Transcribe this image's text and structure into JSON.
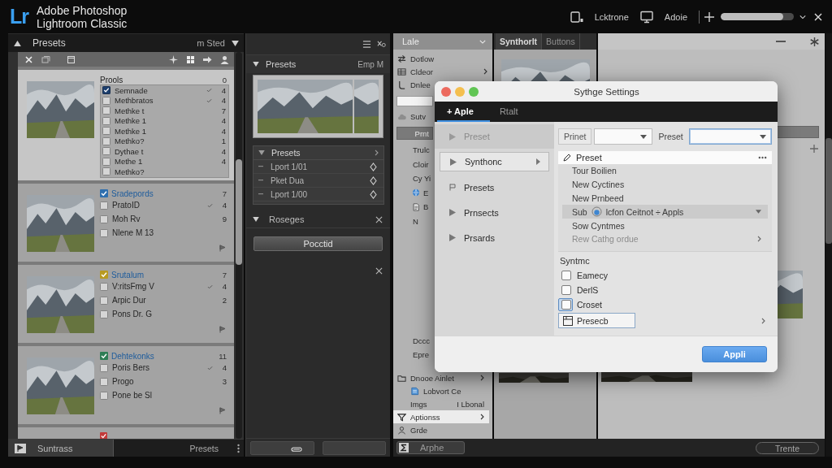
{
  "app_bar": {
    "logo": "Lr",
    "title": [
      "Adobe Photoshop",
      "Lightroom Classic"
    ],
    "tools": [
      {
        "kind": "device",
        "label": "Lcktrone"
      },
      {
        "kind": "monitor",
        "label": "Adoie"
      }
    ],
    "zoom": {
      "level": 0.86
    }
  },
  "presets_panel": {
    "title": "Presets",
    "filter": "m Sted",
    "cards": [
      {
        "selected": true,
        "title": "Prools",
        "count": "0",
        "flag": false,
        "rows": [
          {
            "label": "Semnade",
            "checked": true,
            "ticked": true,
            "count": "4"
          },
          {
            "label": "Methbratos",
            "checked": false,
            "ticked": true,
            "count": "4"
          },
          {
            "label": "Methke t",
            "checked": false,
            "ticked": false,
            "count": "7"
          },
          {
            "label": "Methke 1",
            "checked": false,
            "ticked": false,
            "count": "4"
          },
          {
            "label": "Methke 1",
            "checked": false,
            "ticked": false,
            "count": "4"
          },
          {
            "label": "Methko?",
            "checked": false,
            "ticked": false,
            "count": "1"
          },
          {
            "label": "Dythae t",
            "checked": false,
            "ticked": false,
            "count": "4"
          },
          {
            "label": "Methe 1",
            "checked": false,
            "ticked": false,
            "count": "4"
          },
          {
            "label": "Methko?",
            "checked": false,
            "ticked": false
          }
        ]
      },
      {
        "selected": false,
        "title": "Sradepords",
        "color": "#2f6fae",
        "count": "7",
        "flag": true,
        "rows": [
          {
            "label": "PratoID",
            "checked": false,
            "ticked": true,
            "count": "4"
          },
          {
            "label": "Moh Rv",
            "checked": false,
            "ticked": false,
            "count": "9"
          },
          {
            "label": "Nlene M 13",
            "checked": false,
            "ticked": false
          }
        ]
      },
      {
        "selected": false,
        "title": "Srutalum",
        "color": "#b89a22",
        "count": "7",
        "flag": true,
        "rows": [
          {
            "label": "V:ritsFmg V",
            "checked": false,
            "ticked": true,
            "count": "4"
          },
          {
            "label": "Arpic Dur",
            "checked": false,
            "ticked": false,
            "count": "2"
          },
          {
            "label": "Pons Dr. G",
            "checked": false,
            "ticked": false
          }
        ]
      },
      {
        "selected": false,
        "title": "Dehtekonks",
        "color": "#2e7d55",
        "count": "11",
        "flag": true,
        "rows": [
          {
            "label": "Poris Bers",
            "checked": false,
            "ticked": true,
            "count": "4"
          },
          {
            "label": "Progo",
            "checked": false,
            "ticked": false,
            "count": "3"
          },
          {
            "label": "Pone be Sl",
            "checked": false,
            "ticked": false
          }
        ]
      },
      {
        "selected": false,
        "color": "#c23a3a",
        "flag": false
      }
    ],
    "footer": {
      "button": "Suntrass",
      "label": "Presets"
    }
  },
  "develop_panel": {
    "title": "Presets",
    "meta": "Emp M",
    "list_title": "Presets",
    "items": [
      "Lport 1/01",
      "Pket Dua",
      "Lport 1/00"
    ],
    "section": "Roseges",
    "button": "Pocctid"
  },
  "library": {
    "title": "Lale",
    "items": [
      {
        "kind": "swap",
        "label": "Dotlow",
        "more": false
      },
      {
        "kind": "grid",
        "label": "Cldeor",
        "more": true
      },
      {
        "kind": "hook",
        "label": "Dnlee",
        "more": false
      }
    ],
    "sync": {
      "kind": "cloud",
      "label": "Sutv"
    },
    "button": "Prnt",
    "list": [
      {
        "label": "Trulc"
      },
      {
        "label": "Cloir"
      },
      {
        "label": "Cy Yi"
      },
      {
        "kind": "globe",
        "label": "E"
      },
      {
        "kind": "doc",
        "label": "B"
      },
      {
        "label": "N"
      }
    ],
    "lower": [
      "Dccc",
      "Epre"
    ],
    "nav": [
      {
        "kind": "folder",
        "label": "Dnooe Ainlet",
        "more": true,
        "selected": false,
        "children": [
          {
            "kind": "bluedoc",
            "label": "Lobvort Ce",
            "more": false,
            "selected": false
          }
        ]
      },
      {
        "label": "Imgs",
        "meta": "I Lbonal",
        "more": false,
        "selected": false
      },
      {
        "kind": "funnel",
        "label": "Aptionss",
        "more": true,
        "selected": true
      },
      {
        "kind": "person",
        "label": "Grde",
        "more": false,
        "selected": false
      }
    ],
    "footer_button": "Arphe"
  },
  "filmstrip": {
    "tabs": [
      {
        "label": "Synthorlt",
        "selected": true
      },
      {
        "label": "Buttons",
        "selected": false
      }
    ]
  },
  "viewer": {
    "button": "Trente"
  },
  "dialog": {
    "title": "Sythge Settings",
    "tabs": [
      {
        "label": "+ Aple",
        "selected": true
      },
      {
        "label": "Rtalt",
        "selected": false
      }
    ],
    "sidebar": [
      {
        "kind": "arrow",
        "label": "Preset",
        "selected": false,
        "disabled": true,
        "more": false
      },
      {
        "kind": "arrow",
        "label": "Synthonc",
        "selected": true,
        "disabled": false,
        "more": true
      },
      {
        "kind": "flag",
        "label": "Presets",
        "selected": false,
        "disabled": false,
        "more": false
      },
      {
        "kind": "arrow",
        "label": "Prnsects",
        "selected": false,
        "disabled": false,
        "more": false
      },
      {
        "kind": "arrow",
        "label": "Prsards",
        "selected": false,
        "disabled": false,
        "more": false
      }
    ],
    "filters": [
      {
        "kind": "label",
        "label": "Prinet"
      },
      {
        "kind": "select",
        "focused": false
      },
      {
        "kind": "text",
        "label": "Preset"
      },
      {
        "kind": "select",
        "focused": true
      }
    ],
    "list": {
      "title": "Preset",
      "items": [
        {
          "label": "Tour Boilien",
          "selected": false,
          "disabled": false,
          "more": false
        },
        {
          "label": "New Cyctines",
          "selected": false,
          "disabled": false,
          "more": false
        },
        {
          "label": "New Prnbeed",
          "selected": false,
          "disabled": false,
          "more": false
        },
        {
          "kind": "combo",
          "prefix": "Sub",
          "label": "lcfon Ceitnot ÷ Appls",
          "selected": true,
          "disabled": false,
          "more": false
        },
        {
          "label": "Sow Cyntmes",
          "selected": false,
          "disabled": false,
          "more": false
        },
        {
          "label": "Rew Cathg ordue",
          "selected": false,
          "disabled": true,
          "more": true
        }
      ]
    },
    "section": "Syntmc",
    "options": [
      {
        "kind": "check",
        "label": "Eamecy",
        "checked": false,
        "focused": false
      },
      {
        "kind": "check",
        "label": "DerlS",
        "checked": false,
        "focused": false
      },
      {
        "kind": "check",
        "label": "Croset",
        "checked": false,
        "focused": true
      },
      {
        "kind": "field",
        "label": "Presecb",
        "more": true
      }
    ],
    "apply": "Appli"
  }
}
